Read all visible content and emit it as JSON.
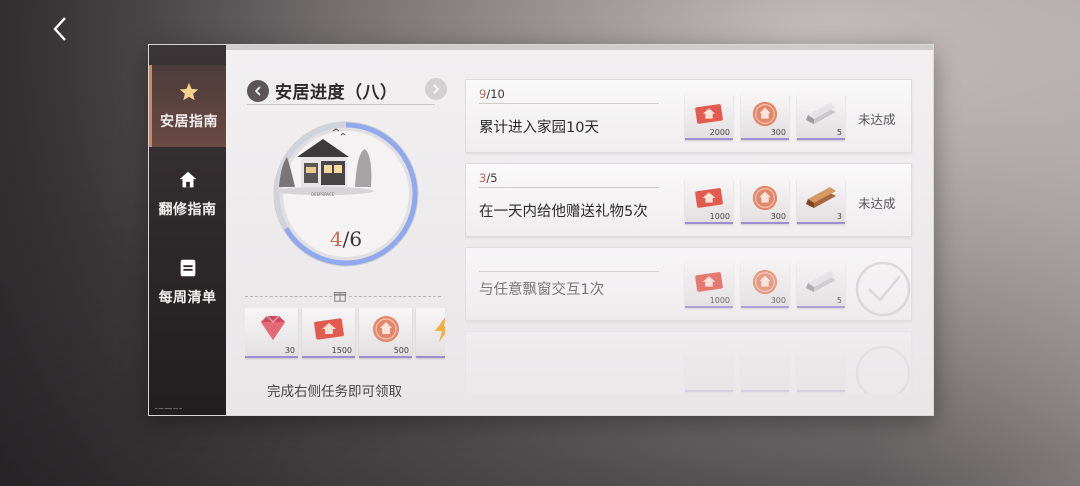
{
  "nav": {
    "back_icon": "chevron-left-icon"
  },
  "sidebar": {
    "items": [
      {
        "label": "安居指南",
        "icon": "star-icon",
        "active": true
      },
      {
        "label": "翻修指南",
        "icon": "home-icon",
        "active": false
      },
      {
        "label": "每周清单",
        "icon": "list-icon",
        "active": false
      }
    ]
  },
  "progress": {
    "title": "安居进度（八）",
    "current": "4",
    "total": "6",
    "fraction": 0.6667,
    "house_caption": "DEEPSPACE",
    "claim_hint": "完成右侧任务即可领取",
    "rewards": [
      {
        "icon": "gem-icon",
        "qty": "30"
      },
      {
        "icon": "ticket-icon",
        "qty": "1500"
      },
      {
        "icon": "coin-icon",
        "qty": "500"
      },
      {
        "icon": "bolt-icon",
        "qty": ""
      }
    ]
  },
  "tasks": [
    {
      "progress_current": "9",
      "progress_total": "/10",
      "desc": "累计进入家园10天",
      "status": "未达成",
      "done": false,
      "rewards": [
        {
          "icon": "ticket-icon",
          "qty": "2000"
        },
        {
          "icon": "coin-icon",
          "qty": "300"
        },
        {
          "icon": "silver-plank-icon",
          "qty": "5"
        }
      ]
    },
    {
      "progress_current": "3",
      "progress_total": "/5",
      "desc": "在一天内给他赠送礼物5次",
      "status": "未达成",
      "done": false,
      "rewards": [
        {
          "icon": "ticket-icon",
          "qty": "1000"
        },
        {
          "icon": "coin-icon",
          "qty": "300"
        },
        {
          "icon": "wood-plank-icon",
          "qty": "3"
        }
      ]
    },
    {
      "progress_current": "",
      "progress_total": "",
      "desc": "与任意飘窗交互1次",
      "status": "",
      "done": true,
      "rewards": [
        {
          "icon": "ticket-icon",
          "qty": "1000"
        },
        {
          "icon": "coin-icon",
          "qty": "300"
        },
        {
          "icon": "silver-plank-icon",
          "qty": "5"
        }
      ]
    }
  ],
  "colors": {
    "accent": "#c06a52",
    "ring": "#8fa8ee",
    "sidebar": "#2a2527"
  }
}
